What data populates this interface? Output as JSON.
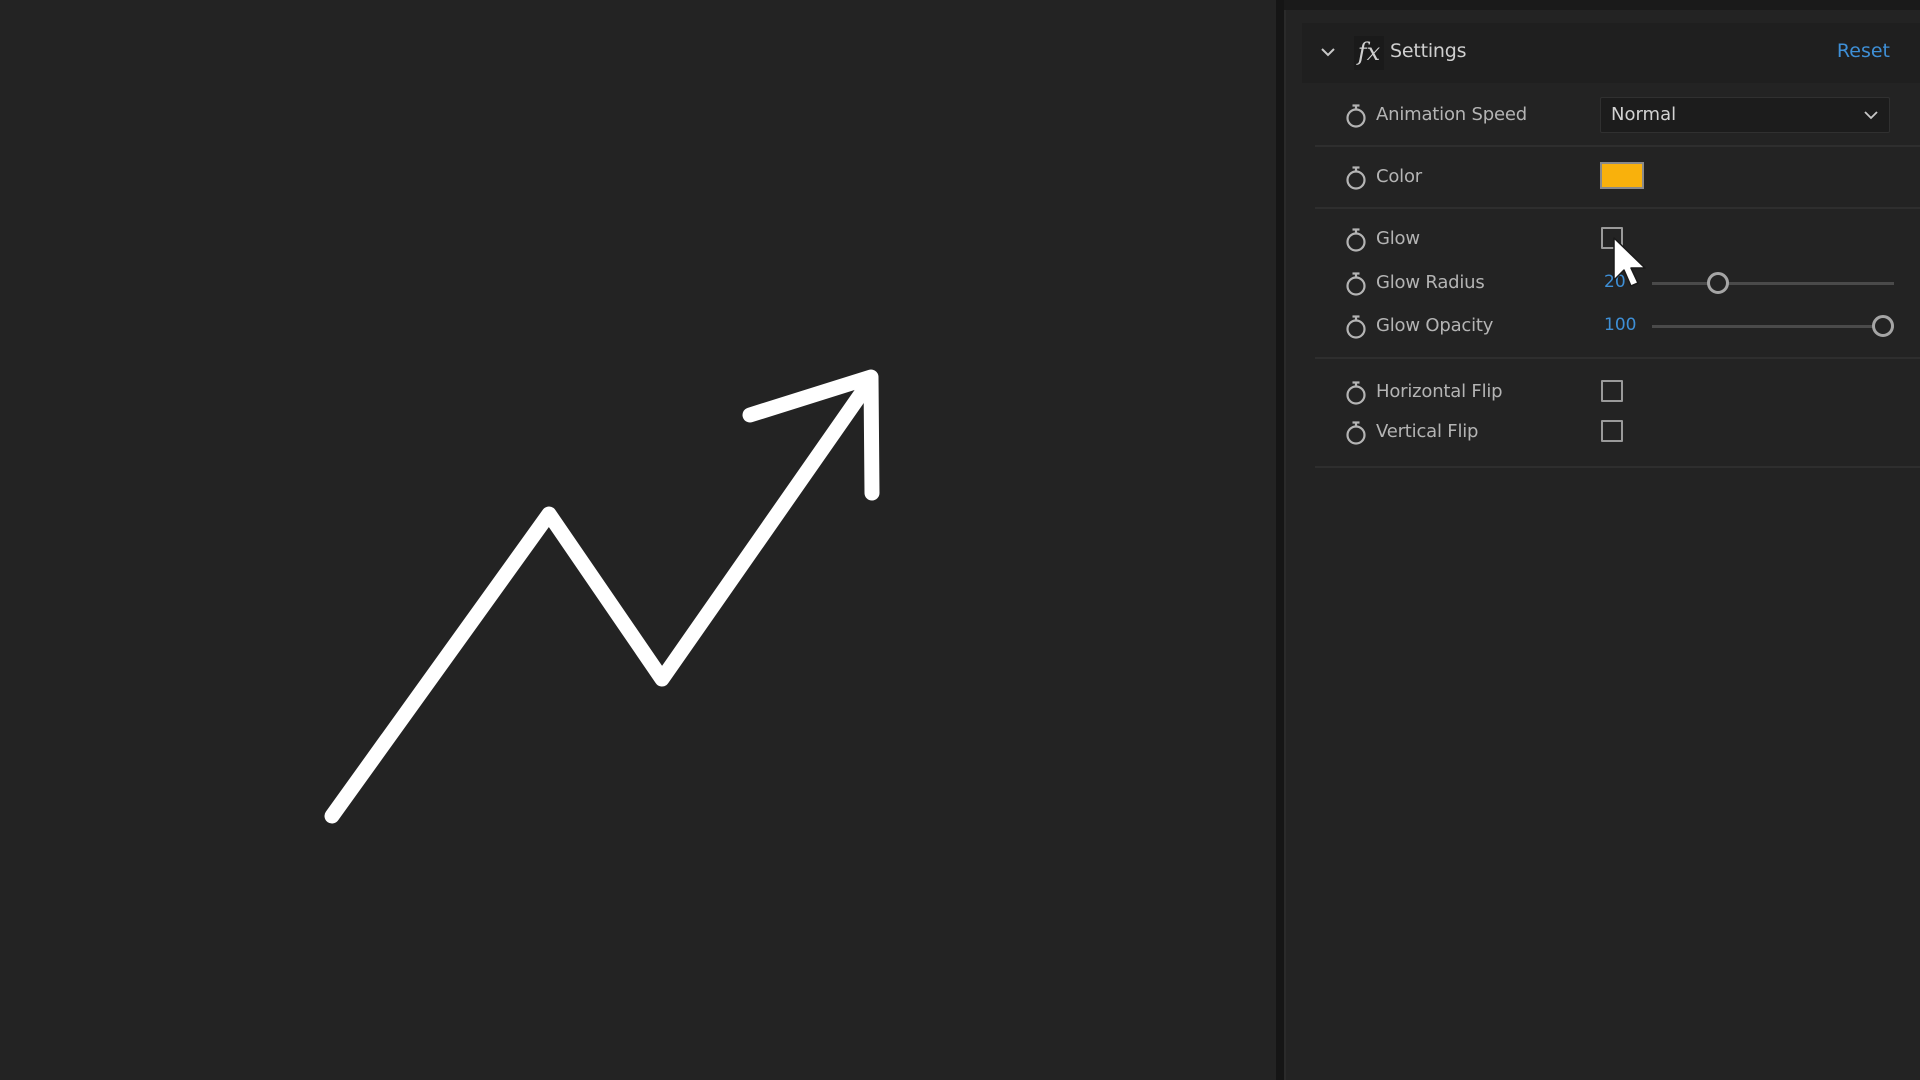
{
  "viewer": {
    "drawing": "hand-drawn zigzag trending-up arrow",
    "stroke_color": "#ffffff"
  },
  "panel": {
    "header": {
      "collapse_icon": "chevron-down-icon",
      "effect_icon": "fx-icon",
      "fx_glyph": "fx",
      "title": "Settings",
      "reset_label": "Reset"
    },
    "properties": {
      "animation_speed": {
        "label": "Animation Speed",
        "value": "Normal",
        "icon": "stopwatch-icon"
      },
      "color": {
        "label": "Color",
        "value": "#f9b10c",
        "icon": "stopwatch-icon"
      },
      "glow": {
        "label": "Glow",
        "checked": false,
        "icon": "stopwatch-icon"
      },
      "glow_radius": {
        "label": "Glow Radius",
        "value": "20",
        "slider_fraction": 0.25,
        "icon": "stopwatch-icon"
      },
      "glow_opacity": {
        "label": "Glow Opacity",
        "value": "100",
        "slider_fraction": 1.0,
        "icon": "stopwatch-icon"
      },
      "horizontal_flip": {
        "label": "Horizontal Flip",
        "checked": false,
        "icon": "stopwatch-icon"
      },
      "vertical_flip": {
        "label": "Vertical Flip",
        "checked": false,
        "icon": "stopwatch-icon"
      }
    }
  },
  "colors": {
    "accent": "#3e8fd6",
    "background": "#232323",
    "text": "#b4b4b4"
  }
}
